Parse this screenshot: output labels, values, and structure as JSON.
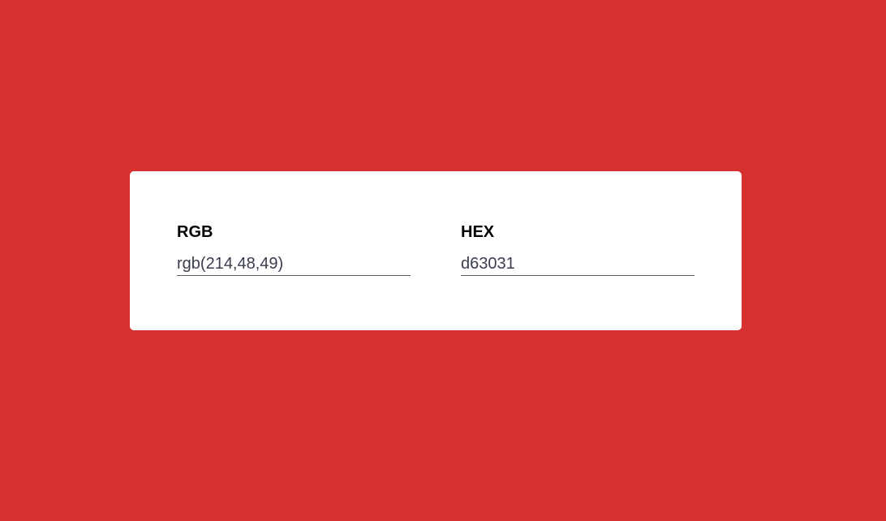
{
  "colors": {
    "background": "#d63031",
    "card": "#ffffff"
  },
  "converter": {
    "rgb": {
      "label": "RGB",
      "value": "rgb(214,48,49)"
    },
    "hex": {
      "label": "HEX",
      "value": "d63031"
    }
  }
}
